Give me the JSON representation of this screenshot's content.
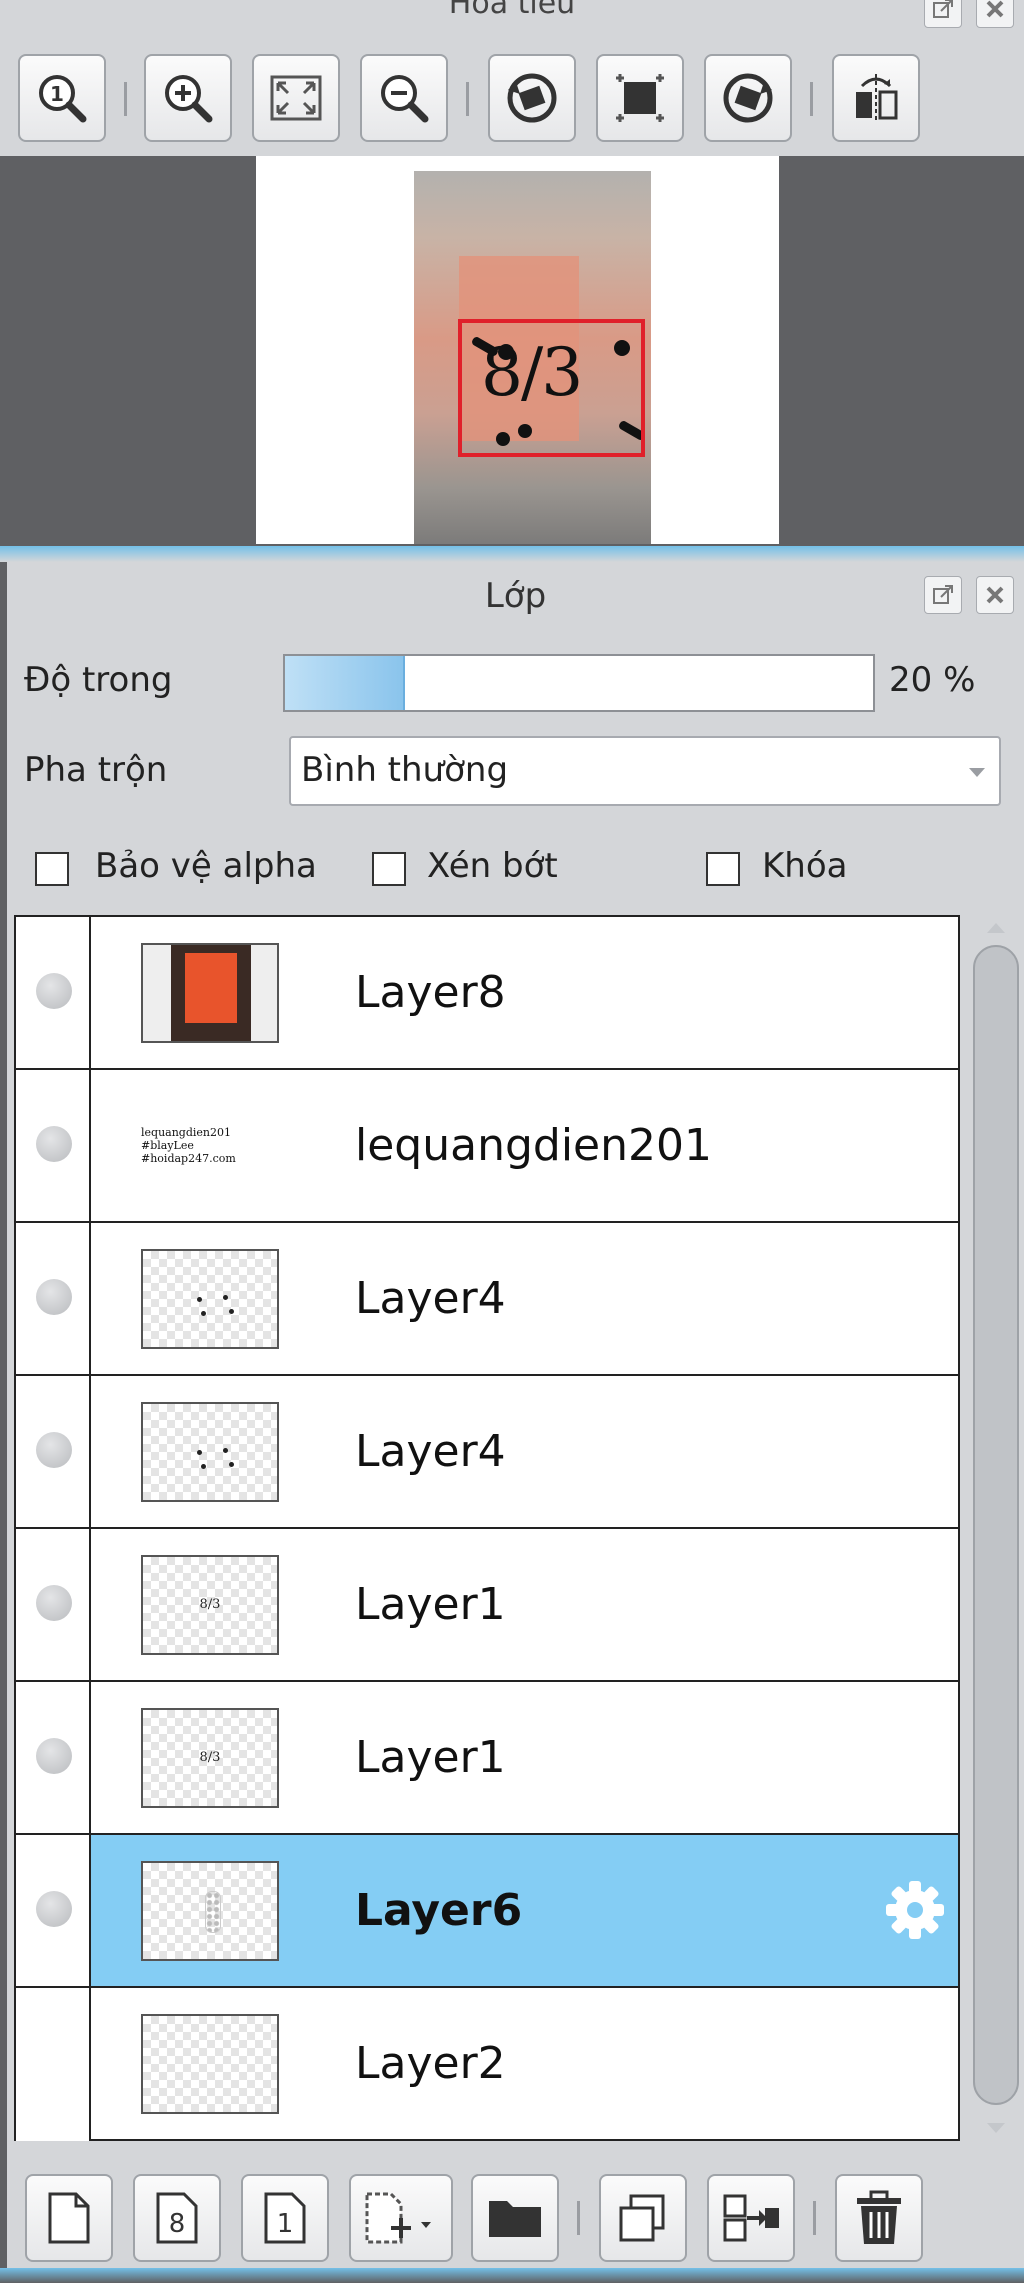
{
  "navigator": {
    "title": "Hoa tieu",
    "preview_text": "8/3"
  },
  "layer_panel": {
    "title": "Lớp",
    "opacity_label": "Độ trong",
    "opacity_value": 20,
    "opacity_text": "20 %",
    "blend_label": "Pha trộn",
    "blend_value": "Bình thường",
    "checkboxes": [
      {
        "label": "Bảo vệ alpha",
        "checked": false
      },
      {
        "label": "Xén bớt",
        "checked": false
      },
      {
        "label": "Khóa",
        "checked": false
      }
    ],
    "layers": [
      {
        "name": "Layer8",
        "visible": true,
        "selected": false,
        "thumb": "photo-icon"
      },
      {
        "name": "lequangdien201",
        "visible": true,
        "selected": false,
        "thumb": "text-icon",
        "thumb_lines": [
          "lequangdien201",
          "#blayLee",
          "#hoidap247.com"
        ]
      },
      {
        "name": "Layer4",
        "visible": true,
        "selected": false,
        "thumb": "dots-icon"
      },
      {
        "name": "Layer4",
        "visible": true,
        "selected": false,
        "thumb": "dots-icon"
      },
      {
        "name": "Layer1",
        "visible": true,
        "selected": false,
        "thumb": "date-icon",
        "thumb_text": "8/3"
      },
      {
        "name": "Layer1",
        "visible": true,
        "selected": false,
        "thumb": "date-icon",
        "thumb_text": "8/3"
      },
      {
        "name": "Layer6",
        "visible": true,
        "selected": true,
        "thumb": "flower-icon"
      },
      {
        "name": "Layer2",
        "visible": false,
        "selected": false,
        "thumb": "blank-icon"
      }
    ]
  },
  "colors": {
    "selected_row": "#84cdf4",
    "accent": "#74c0e8",
    "frame_red": "#e0202a"
  }
}
